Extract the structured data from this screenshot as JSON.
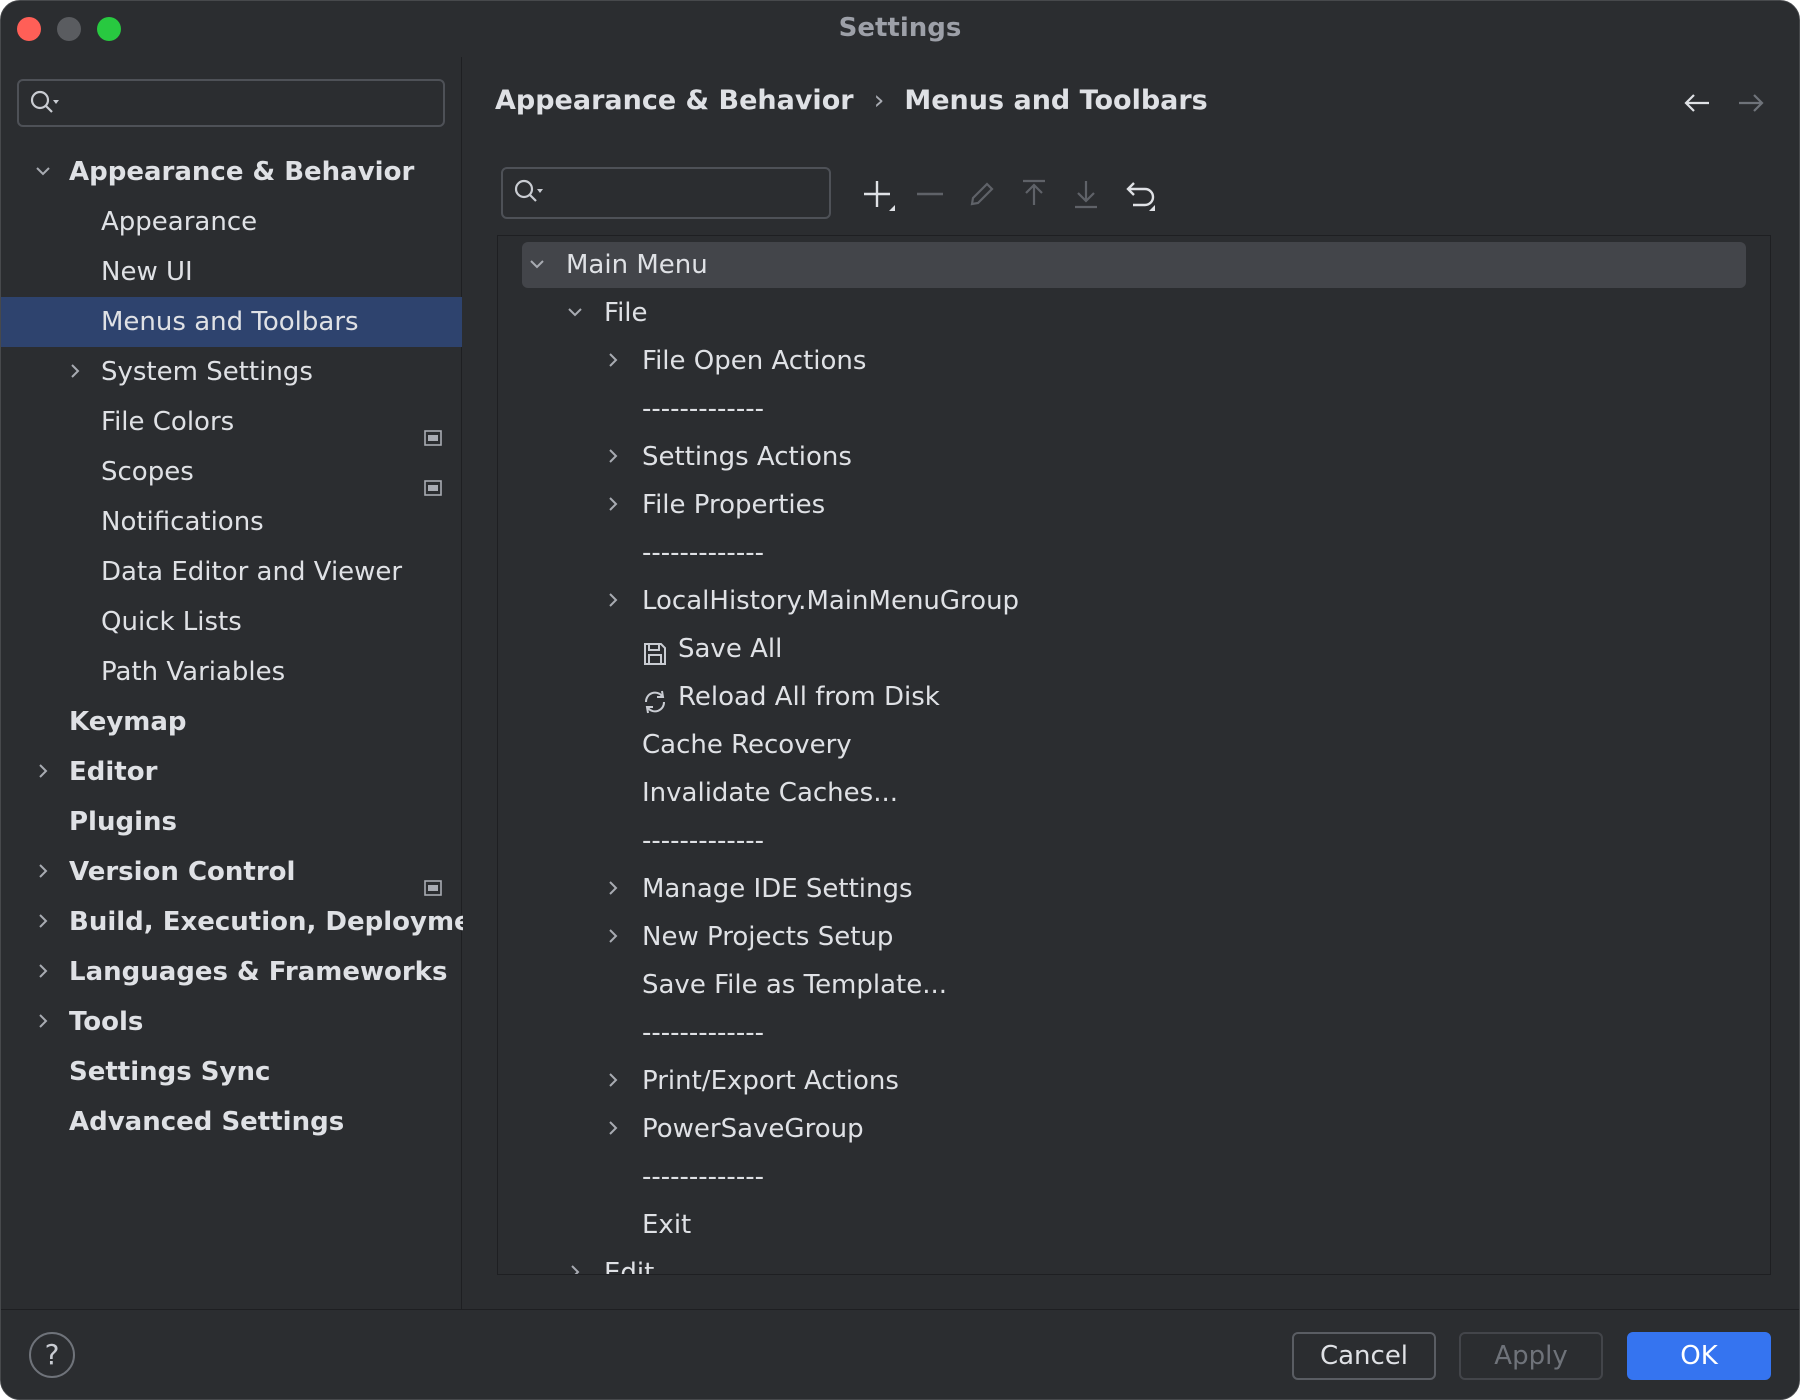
{
  "window": {
    "title": "Settings"
  },
  "left_search": {
    "placeholder": ""
  },
  "nav": {
    "appearance_behavior": "Appearance & Behavior",
    "appearance": "Appearance",
    "new_ui": "New UI",
    "menus_toolbars": "Menus and Toolbars",
    "system_settings": "System Settings",
    "file_colors": "File Colors",
    "scopes": "Scopes",
    "notifications": "Notifications",
    "data_editor": "Data Editor and Viewer",
    "quick_lists": "Quick Lists",
    "path_variables": "Path Variables",
    "keymap": "Keymap",
    "editor": "Editor",
    "plugins": "Plugins",
    "version_control": "Version Control",
    "build": "Build, Execution, Deployment",
    "languages": "Languages & Frameworks",
    "tools": "Tools",
    "settings_sync": "Settings Sync",
    "advanced": "Advanced Settings"
  },
  "breadcrumb": {
    "parent": "Appearance & Behavior",
    "separator": "›",
    "current": "Menus and Toolbars"
  },
  "tree_search": {
    "placeholder": ""
  },
  "tree": {
    "main_menu": "Main Menu",
    "file": "File",
    "file_open_actions": "File Open Actions",
    "sep1": "-------------",
    "settings_actions": "Settings Actions",
    "file_properties": "File Properties",
    "sep2": "-------------",
    "local_history": "LocalHistory.MainMenuGroup",
    "save_all": "Save All",
    "reload_all": "Reload All from Disk",
    "cache_recovery": "Cache Recovery",
    "invalidate_caches": "Invalidate Caches...",
    "sep3": "-------------",
    "manage_ide": "Manage IDE Settings",
    "new_projects": "New Projects Setup",
    "save_template": "Save File as Template...",
    "sep4": "-------------",
    "print_export": "Print/Export Actions",
    "power_save": "PowerSaveGroup",
    "sep5": "-------------",
    "exit": "Exit",
    "edit": "Edit"
  },
  "footer": {
    "help": "?",
    "cancel": "Cancel",
    "apply": "Apply",
    "ok": "OK"
  },
  "colors": {
    "background": "#2b2d30",
    "selection": "#2e436e",
    "tree_selection": "#43454a",
    "accent": "#3574f0"
  }
}
